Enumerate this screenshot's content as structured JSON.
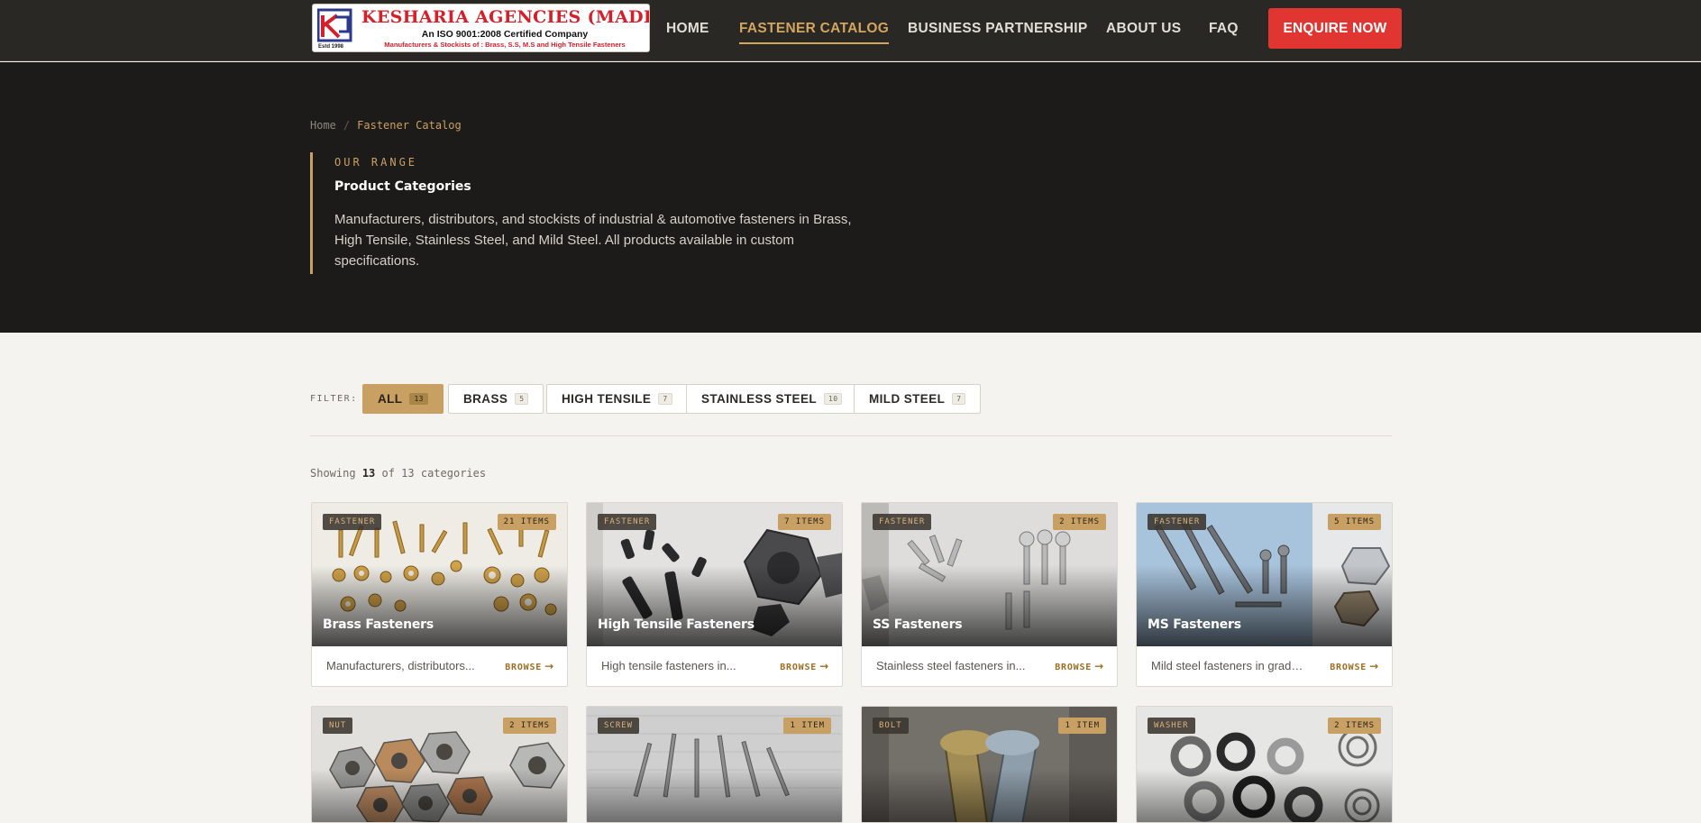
{
  "logo": {
    "title": "KESHARIA AGENCIES (MADRAS)",
    "subtitle": "An ISO 9001:2008 Certified Company",
    "tagline": "Manufacturers & Stockists of : Brass, S.S, M.S and High Tensile Fasteners",
    "est": "Estd 1998"
  },
  "nav": {
    "items": [
      "HOME",
      "FASTENER CATALOG",
      "BUSINESS PARTNERSHIP",
      "ABOUT US",
      "FAQ"
    ],
    "active": "FASTENER CATALOG",
    "cta": "ENQUIRE NOW"
  },
  "breadcrumb": {
    "home": "Home",
    "separator": "/",
    "current": "Fastener Catalog"
  },
  "hero": {
    "eyebrow": "OUR RANGE",
    "title": "Product Categories",
    "description": "Manufacturers, distributors, and stockists of industrial & automotive fasteners in Brass, High Tensile, Stainless Steel, and Mild Steel. All products available in custom specifications."
  },
  "filter": {
    "label": "FILTER:",
    "chips": [
      {
        "label": "ALL",
        "count": "13",
        "active": true
      },
      {
        "label": "BRASS",
        "count": "5",
        "active": false
      },
      {
        "label": "HIGH TENSILE",
        "count": "7",
        "active": false
      },
      {
        "label": "STAINLESS STEEL",
        "count": "10",
        "active": false
      },
      {
        "label": "MILD STEEL",
        "count": "7",
        "active": false
      }
    ]
  },
  "showing": {
    "prefix": "Showing",
    "shown": "13",
    "suffix": "of 13 categories"
  },
  "cards": [
    {
      "tag": "FASTENER",
      "items": "21 ITEMS",
      "title": "Brass Fasteners",
      "desc": "Manufacturers, distributors...",
      "browse": "BROWSE"
    },
    {
      "tag": "FASTENER",
      "items": "7 ITEMS",
      "title": "High Tensile Fasteners",
      "desc": "High tensile fasteners in...",
      "browse": "BROWSE"
    },
    {
      "tag": "FASTENER",
      "items": "2 ITEMS",
      "title": "SS Fasteners",
      "desc": "Stainless steel fasteners in...",
      "browse": "BROWSE"
    },
    {
      "tag": "FASTENER",
      "items": "5 ITEMS",
      "title": "MS Fasteners",
      "desc": "Mild steel fasteners in grade...",
      "browse": "BROWSE"
    },
    {
      "tag": "NUT",
      "items": "2 ITEMS",
      "title": "",
      "desc": "",
      "browse": ""
    },
    {
      "tag": "SCREW",
      "items": "1 ITEM",
      "title": "",
      "desc": "",
      "browse": ""
    },
    {
      "tag": "BOLT",
      "items": "1 ITEM",
      "title": "",
      "desc": "",
      "browse": ""
    },
    {
      "tag": "WASHER",
      "items": "2 ITEMS",
      "title": "",
      "desc": "",
      "browse": ""
    }
  ],
  "colors": {
    "accent": "#c9a063",
    "cta": "#e03531",
    "nav_bg": "#2a2825",
    "hero_bg": "#1c1b19",
    "page_bg": "#f4f3ef"
  }
}
